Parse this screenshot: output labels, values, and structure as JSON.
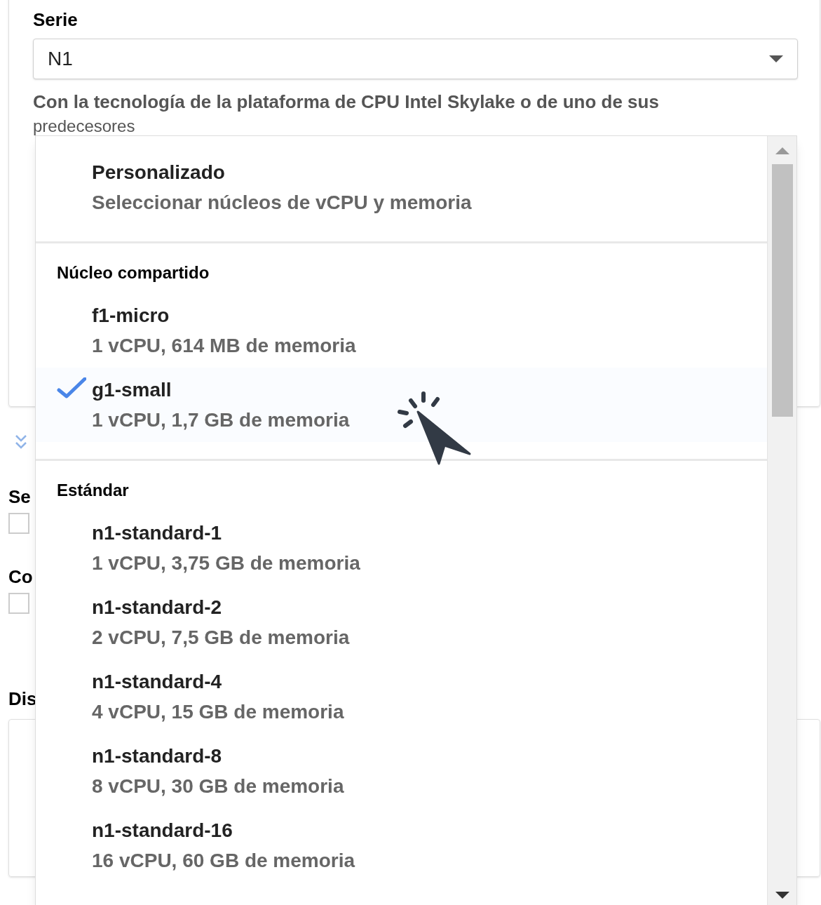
{
  "series_field": {
    "label": "Serie",
    "value": "N1",
    "description": "Con la tecnología de la plataforma de CPU Intel Skylake o de uno de sus",
    "description_cut": "predecesores"
  },
  "background_fragments": {
    "label_1": "Se",
    "label_2": "Co",
    "label_3": "Dis",
    "checkbox_1": {
      "checked": false
    },
    "checkbox_2": {
      "checked": false
    }
  },
  "dropdown": {
    "groups": [
      {
        "items": [
          {
            "name": "Personalizado",
            "detail": "Seleccionar núcleos de vCPU y memoria",
            "selected": false
          }
        ]
      },
      {
        "header": "Núcleo compartido",
        "items": [
          {
            "name": "f1-micro",
            "detail": "1 vCPU, 614 MB de memoria",
            "selected": false
          },
          {
            "name": "g1-small",
            "detail": "1 vCPU, 1,7 GB de memoria",
            "selected": true
          }
        ]
      },
      {
        "header": "Estándar",
        "items": [
          {
            "name": "n1-standard-1",
            "detail": "1 vCPU, 3,75 GB de memoria",
            "selected": false
          },
          {
            "name": "n1-standard-2",
            "detail": "2 vCPU, 7,5 GB de memoria",
            "selected": false
          },
          {
            "name": "n1-standard-4",
            "detail": "4 vCPU, 15 GB de memoria",
            "selected": false
          },
          {
            "name": "n1-standard-8",
            "detail": "8 vCPU, 30 GB de memoria",
            "selected": false
          },
          {
            "name": "n1-standard-16",
            "detail": "16 vCPU, 60 GB de memoria",
            "selected": false
          }
        ]
      }
    ]
  }
}
